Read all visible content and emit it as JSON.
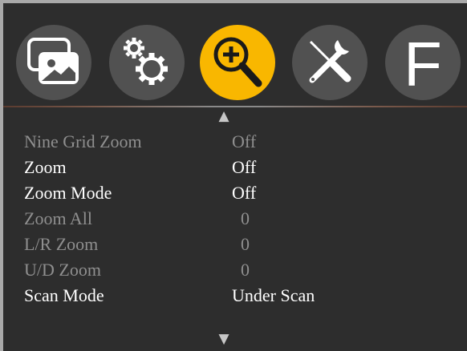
{
  "colors": {
    "accent": "#f9b700",
    "tab_bg": "#515151",
    "panel_bg": "#2d2d2d",
    "text_enabled": "#ffffff",
    "text_disabled": "#8f8f8f"
  },
  "tabs": [
    {
      "icon": "picture-icon",
      "active": false
    },
    {
      "icon": "gears-icon",
      "active": false
    },
    {
      "icon": "zoom-in-icon",
      "active": true
    },
    {
      "icon": "tools-icon",
      "active": false
    },
    {
      "icon": "f-letter-icon",
      "letter": "F",
      "active": false
    }
  ],
  "scroll": {
    "up": "▲",
    "down": "▼"
  },
  "menu": {
    "items": [
      {
        "label": "Nine Grid Zoom",
        "value": "Off",
        "enabled": false
      },
      {
        "label": "Zoom",
        "value": "Off",
        "enabled": true
      },
      {
        "label": "Zoom Mode",
        "value": "Off",
        "enabled": true
      },
      {
        "label": "Zoom All",
        "value": " 0",
        "enabled": false
      },
      {
        "label": "L/R Zoom",
        "value": " 0",
        "enabled": false
      },
      {
        "label": "U/D Zoom",
        "value": " 0",
        "enabled": false
      },
      {
        "label": "Scan Mode",
        "value": "Under Scan",
        "enabled": true
      }
    ]
  }
}
